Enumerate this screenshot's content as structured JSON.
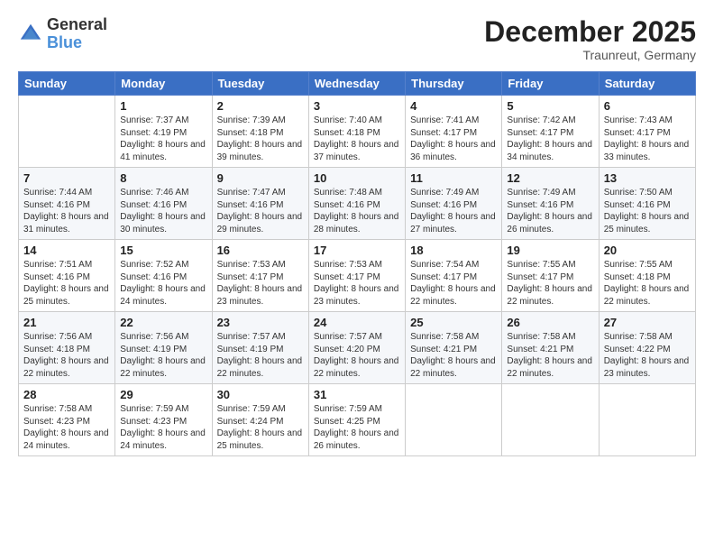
{
  "header": {
    "logo_general": "General",
    "logo_blue": "Blue",
    "month_title": "December 2025",
    "location": "Traunreut, Germany"
  },
  "days_of_week": [
    "Sunday",
    "Monday",
    "Tuesday",
    "Wednesday",
    "Thursday",
    "Friday",
    "Saturday"
  ],
  "weeks": [
    [
      {
        "day": "",
        "sunrise": "",
        "sunset": "",
        "daylight": ""
      },
      {
        "day": "1",
        "sunrise": "Sunrise: 7:37 AM",
        "sunset": "Sunset: 4:19 PM",
        "daylight": "Daylight: 8 hours and 41 minutes."
      },
      {
        "day": "2",
        "sunrise": "Sunrise: 7:39 AM",
        "sunset": "Sunset: 4:18 PM",
        "daylight": "Daylight: 8 hours and 39 minutes."
      },
      {
        "day": "3",
        "sunrise": "Sunrise: 7:40 AM",
        "sunset": "Sunset: 4:18 PM",
        "daylight": "Daylight: 8 hours and 37 minutes."
      },
      {
        "day": "4",
        "sunrise": "Sunrise: 7:41 AM",
        "sunset": "Sunset: 4:17 PM",
        "daylight": "Daylight: 8 hours and 36 minutes."
      },
      {
        "day": "5",
        "sunrise": "Sunrise: 7:42 AM",
        "sunset": "Sunset: 4:17 PM",
        "daylight": "Daylight: 8 hours and 34 minutes."
      },
      {
        "day": "6",
        "sunrise": "Sunrise: 7:43 AM",
        "sunset": "Sunset: 4:17 PM",
        "daylight": "Daylight: 8 hours and 33 minutes."
      }
    ],
    [
      {
        "day": "7",
        "sunrise": "Sunrise: 7:44 AM",
        "sunset": "Sunset: 4:16 PM",
        "daylight": "Daylight: 8 hours and 31 minutes."
      },
      {
        "day": "8",
        "sunrise": "Sunrise: 7:46 AM",
        "sunset": "Sunset: 4:16 PM",
        "daylight": "Daylight: 8 hours and 30 minutes."
      },
      {
        "day": "9",
        "sunrise": "Sunrise: 7:47 AM",
        "sunset": "Sunset: 4:16 PM",
        "daylight": "Daylight: 8 hours and 29 minutes."
      },
      {
        "day": "10",
        "sunrise": "Sunrise: 7:48 AM",
        "sunset": "Sunset: 4:16 PM",
        "daylight": "Daylight: 8 hours and 28 minutes."
      },
      {
        "day": "11",
        "sunrise": "Sunrise: 7:49 AM",
        "sunset": "Sunset: 4:16 PM",
        "daylight": "Daylight: 8 hours and 27 minutes."
      },
      {
        "day": "12",
        "sunrise": "Sunrise: 7:49 AM",
        "sunset": "Sunset: 4:16 PM",
        "daylight": "Daylight: 8 hours and 26 minutes."
      },
      {
        "day": "13",
        "sunrise": "Sunrise: 7:50 AM",
        "sunset": "Sunset: 4:16 PM",
        "daylight": "Daylight: 8 hours and 25 minutes."
      }
    ],
    [
      {
        "day": "14",
        "sunrise": "Sunrise: 7:51 AM",
        "sunset": "Sunset: 4:16 PM",
        "daylight": "Daylight: 8 hours and 25 minutes."
      },
      {
        "day": "15",
        "sunrise": "Sunrise: 7:52 AM",
        "sunset": "Sunset: 4:16 PM",
        "daylight": "Daylight: 8 hours and 24 minutes."
      },
      {
        "day": "16",
        "sunrise": "Sunrise: 7:53 AM",
        "sunset": "Sunset: 4:17 PM",
        "daylight": "Daylight: 8 hours and 23 minutes."
      },
      {
        "day": "17",
        "sunrise": "Sunrise: 7:53 AM",
        "sunset": "Sunset: 4:17 PM",
        "daylight": "Daylight: 8 hours and 23 minutes."
      },
      {
        "day": "18",
        "sunrise": "Sunrise: 7:54 AM",
        "sunset": "Sunset: 4:17 PM",
        "daylight": "Daylight: 8 hours and 22 minutes."
      },
      {
        "day": "19",
        "sunrise": "Sunrise: 7:55 AM",
        "sunset": "Sunset: 4:17 PM",
        "daylight": "Daylight: 8 hours and 22 minutes."
      },
      {
        "day": "20",
        "sunrise": "Sunrise: 7:55 AM",
        "sunset": "Sunset: 4:18 PM",
        "daylight": "Daylight: 8 hours and 22 minutes."
      }
    ],
    [
      {
        "day": "21",
        "sunrise": "Sunrise: 7:56 AM",
        "sunset": "Sunset: 4:18 PM",
        "daylight": "Daylight: 8 hours and 22 minutes."
      },
      {
        "day": "22",
        "sunrise": "Sunrise: 7:56 AM",
        "sunset": "Sunset: 4:19 PM",
        "daylight": "Daylight: 8 hours and 22 minutes."
      },
      {
        "day": "23",
        "sunrise": "Sunrise: 7:57 AM",
        "sunset": "Sunset: 4:19 PM",
        "daylight": "Daylight: 8 hours and 22 minutes."
      },
      {
        "day": "24",
        "sunrise": "Sunrise: 7:57 AM",
        "sunset": "Sunset: 4:20 PM",
        "daylight": "Daylight: 8 hours and 22 minutes."
      },
      {
        "day": "25",
        "sunrise": "Sunrise: 7:58 AM",
        "sunset": "Sunset: 4:21 PM",
        "daylight": "Daylight: 8 hours and 22 minutes."
      },
      {
        "day": "26",
        "sunrise": "Sunrise: 7:58 AM",
        "sunset": "Sunset: 4:21 PM",
        "daylight": "Daylight: 8 hours and 22 minutes."
      },
      {
        "day": "27",
        "sunrise": "Sunrise: 7:58 AM",
        "sunset": "Sunset: 4:22 PM",
        "daylight": "Daylight: 8 hours and 23 minutes."
      }
    ],
    [
      {
        "day": "28",
        "sunrise": "Sunrise: 7:58 AM",
        "sunset": "Sunset: 4:23 PM",
        "daylight": "Daylight: 8 hours and 24 minutes."
      },
      {
        "day": "29",
        "sunrise": "Sunrise: 7:59 AM",
        "sunset": "Sunset: 4:23 PM",
        "daylight": "Daylight: 8 hours and 24 minutes."
      },
      {
        "day": "30",
        "sunrise": "Sunrise: 7:59 AM",
        "sunset": "Sunset: 4:24 PM",
        "daylight": "Daylight: 8 hours and 25 minutes."
      },
      {
        "day": "31",
        "sunrise": "Sunrise: 7:59 AM",
        "sunset": "Sunset: 4:25 PM",
        "daylight": "Daylight: 8 hours and 26 minutes."
      },
      {
        "day": "",
        "sunrise": "",
        "sunset": "",
        "daylight": ""
      },
      {
        "day": "",
        "sunrise": "",
        "sunset": "",
        "daylight": ""
      },
      {
        "day": "",
        "sunrise": "",
        "sunset": "",
        "daylight": ""
      }
    ]
  ]
}
